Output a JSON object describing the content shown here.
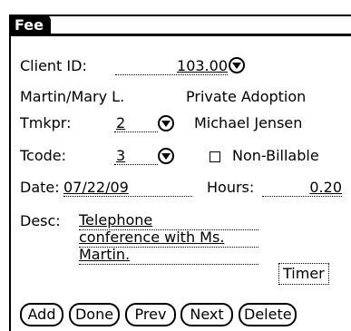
{
  "form": {
    "title": "Fee",
    "client_id_label": "Client ID:",
    "client_id_value": "103.00",
    "client_name": "Martin/Mary L.",
    "matter": "Private Adoption",
    "tmkpr_label": "Tmkpr:",
    "tmkpr_value": "2",
    "tmkpr_name": "Michael Jensen",
    "tcode_label": "Tcode:",
    "tcode_value": "3",
    "non_billable_label": "Non-Billable",
    "non_billable_checked": false,
    "date_label": "Date:",
    "date_value": "07/22/09",
    "hours_label": "Hours:",
    "hours_value": "0.20",
    "desc_label": "Desc:",
    "desc_lines": [
      "Telephone",
      "conference with Ms.",
      "Martin."
    ],
    "timer_label": "Timer"
  },
  "buttons": {
    "add": "Add",
    "done": "Done",
    "prev": "Prev",
    "next": "Next",
    "delete": "Delete"
  }
}
